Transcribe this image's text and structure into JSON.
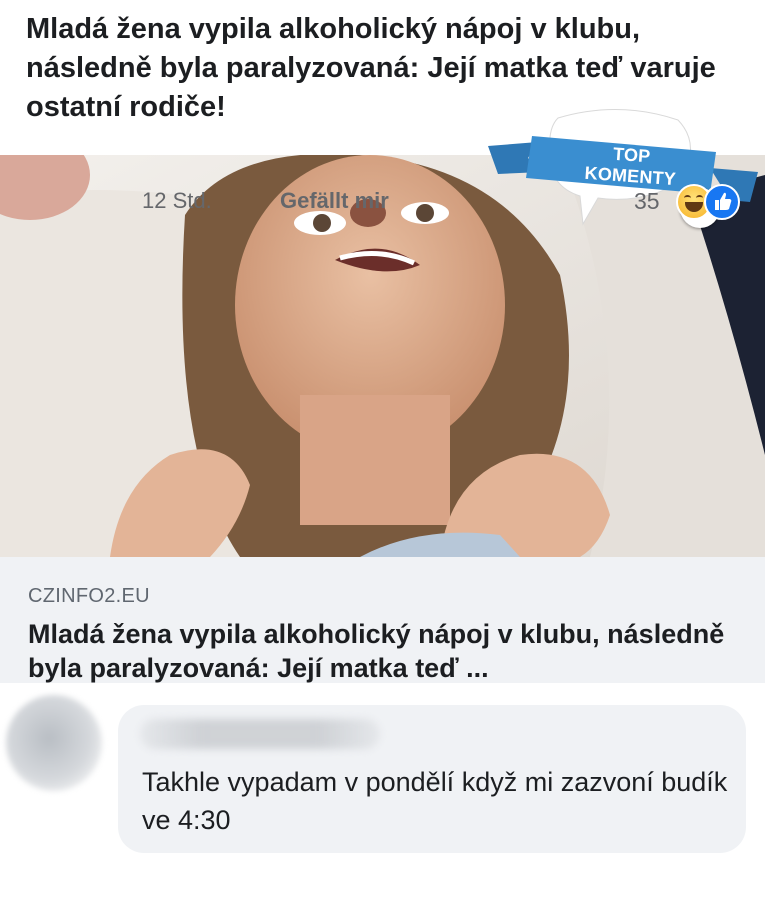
{
  "post": {
    "headline": "Mladá žena vypila alkoholický nápoj v klubu, následně byla paralyzovaná: Její matka teď varuje ostatní rodiče!"
  },
  "badge": {
    "label": "TOP KOMENTY",
    "info_icon": "i"
  },
  "link_card": {
    "domain": "CZINFO2.EU",
    "title": "Mladá žena vypila alkoholický nápoj v klubu, následně byla paralyzovaná: Její matka teď ..."
  },
  "comment": {
    "text": "Takhle vypadam v pondělí když mi zazvoní budík ve 4:30",
    "time": "12 Std.",
    "like_label": "Gefällt mir",
    "reaction_count": "35",
    "reactions": [
      "haha-icon",
      "like-icon"
    ]
  },
  "colors": {
    "badge_ribbon": "#3a8ed0",
    "like_blue": "#1877f2",
    "card_background": "#f0f2f5"
  }
}
